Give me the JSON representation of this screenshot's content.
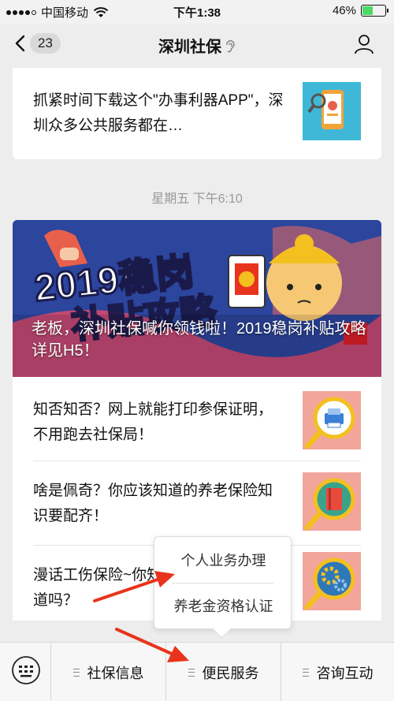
{
  "status_bar": {
    "carrier": "中国移动",
    "time": "下午1:38",
    "battery": "46%",
    "battery_level": 0.46
  },
  "nav": {
    "unread_count": "23",
    "title": "深圳社保"
  },
  "articles_top": [
    {
      "text": "抓紧时间下载这个\"办事利器APP\"，深圳众多公共服务都在…"
    }
  ],
  "timestamp": "星期五 下午6:10",
  "banner": {
    "art_text_1": "2019稳岗",
    "art_text_2": "补贴攻略",
    "caption": "老板，深圳社保喊你领钱啦！2019稳岗补贴攻略详见H5！"
  },
  "articles": [
    {
      "text": "知否知否？网上就能打印参保证明，不用跑去社保局！"
    },
    {
      "text": "啥是佩奇？你应该知道的养老保险知识要配齐！"
    },
    {
      "text": "漫话工伤保险~你知道吗？"
    }
  ],
  "popup_menu": {
    "items": [
      "个人业务办理",
      "养老金资格认证"
    ]
  },
  "bottom_menu": {
    "items": [
      "社保信息",
      "便民服务",
      "咨询互动"
    ]
  },
  "colors": {
    "arrow": "#e8341c",
    "thumb_bg": "#f2a59b",
    "battery": "#4cd964"
  }
}
